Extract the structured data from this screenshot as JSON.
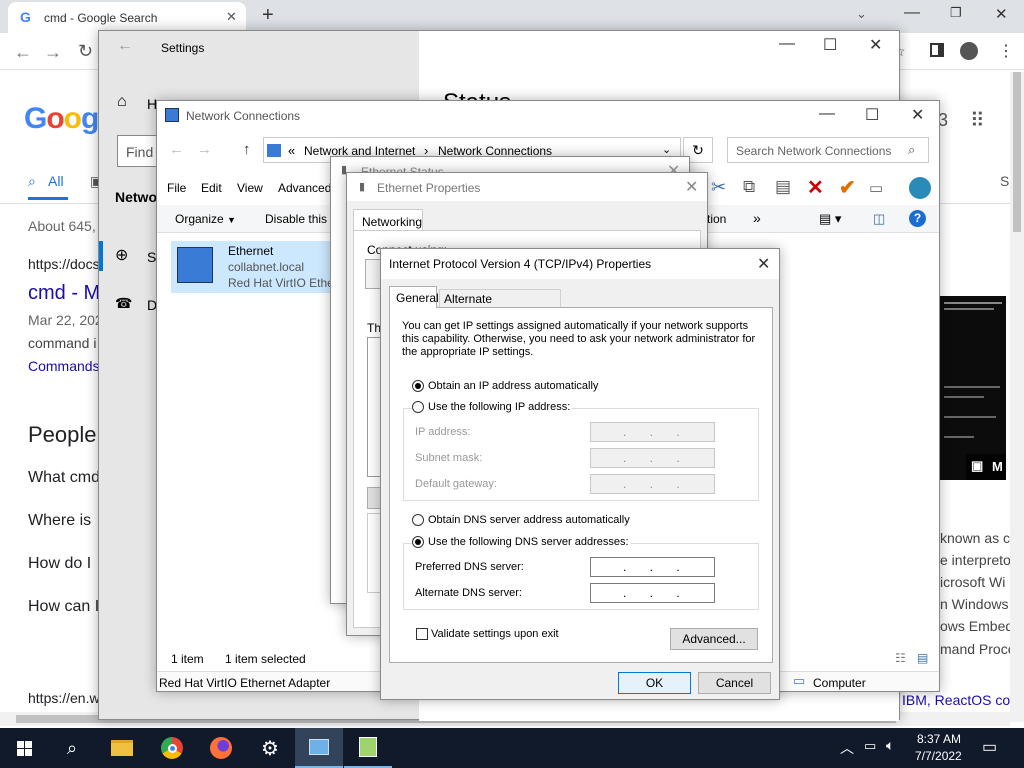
{
  "browser": {
    "tab_title": "cmd - Google Search",
    "new_tab": "+",
    "find_placeholder": "Find",
    "filter_all": "All",
    "result_count": "About 645,",
    "result_url": "https://docs",
    "result_title": "cmd - M",
    "result_date": "Mar 22, 202",
    "result_snippet": "command i",
    "result_link": "Commands",
    "people_heading": "People",
    "questions": [
      "What cmd",
      "Where is",
      "How do I",
      "How can I"
    ],
    "bottom_url": "https://en.w",
    "right_snippets": [
      "known as cr",
      "e interpreto",
      "icrosoft Wi",
      "n Windows",
      "ows Embed",
      "mand Proce"
    ],
    "right_link": "IBM, ReactOS co",
    "right_letter": "S",
    "img_badge": "M",
    "status_heading": "Status"
  },
  "settings": {
    "title": "Settings",
    "home": "H",
    "section": "Netwo",
    "item1": "St",
    "item2": "D"
  },
  "netconn": {
    "title": "Network Connections",
    "breadcrumb_sep": "«",
    "breadcrumb1": "Network and Internet",
    "breadcrumb_arrow": "›",
    "breadcrumb2": "Network Connections",
    "search_placeholder": "Search Network Connections",
    "menu": [
      "File",
      "Edit",
      "View",
      "Advanced"
    ],
    "organize": "Organize",
    "disable": "Disable this n",
    "ction": "ction",
    "more": "»",
    "adapter_name": "Ethernet",
    "adapter_domain": "collabnet.local",
    "adapter_driver": "Red Hat VirtIO Ethe",
    "status_count": "1 item",
    "status_selected": "1 item selected",
    "detail_adapter": "Red Hat VirtIO Ethernet Adapter",
    "detail_computer": "Computer"
  },
  "eth_status": {
    "title": "Ethernet Status"
  },
  "eth_props": {
    "title": "Ethernet Properties",
    "tab": "Networking",
    "connect_using": "Connect using:",
    "this_conn": "Th"
  },
  "ipv4": {
    "title": "Internet Protocol Version 4 (TCP/IPv4) Properties",
    "tab_general": "General",
    "tab_alt": "Alternate Configuration",
    "intro": "You can get IP settings assigned automatically if your network supports this capability. Otherwise, you need to ask your network administrator for the appropriate IP settings.",
    "obtain_ip": "Obtain an IP address automatically",
    "use_ip": "Use the following IP address:",
    "ip_address": "IP address:",
    "subnet": "Subnet mask:",
    "gateway": "Default gateway:",
    "obtain_dns": "Obtain DNS server address automatically",
    "use_dns": "Use the following DNS server addresses:",
    "preferred_dns": "Preferred DNS server:",
    "alternate_dns": "Alternate DNS server:",
    "ip_placeholder": ".       .       .",
    "validate": "Validate settings upon exit",
    "advanced": "Advanced...",
    "ok": "OK",
    "cancel": "Cancel",
    "close": "✕"
  },
  "taskbar": {
    "time": "8:37 AM",
    "date": "7/7/2022"
  },
  "colors": {
    "accent": "#0078d7",
    "google_blue": "#4285f4",
    "google_red": "#ea4335",
    "google_yellow": "#fbbc05",
    "google_green": "#34a853",
    "link": "#1a0dab"
  }
}
